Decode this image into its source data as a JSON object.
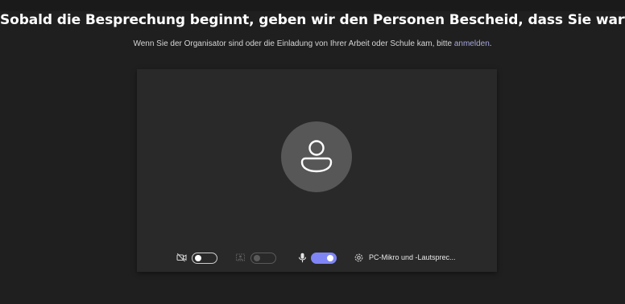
{
  "header": {
    "title": "Sobald die Besprechung beginnt, geben wir den Personen Bescheid, dass Sie warten.",
    "subtitle_prefix": "Wenn Sie der Organisator sind oder die Einladung von Ihrer Arbeit oder Schule kam, bitte ",
    "subtitle_link": "anmelden",
    "subtitle_suffix": "."
  },
  "preview": {
    "avatar_icon": "person-icon",
    "controls": {
      "camera": {
        "icon": "camera-off-icon",
        "state": "off"
      },
      "background": {
        "icon": "background-effects-icon",
        "state": "disabled"
      },
      "microphone": {
        "icon": "microphone-icon",
        "state": "on"
      },
      "audio": {
        "icon": "gear-icon",
        "label": "PC-Mikro und -Lautsprec..."
      }
    }
  },
  "colors": {
    "background": "#1f1f1f",
    "panel": "#292929",
    "avatar": "#575757",
    "accent": "#7f85f5",
    "link": "#a6a7dc"
  }
}
